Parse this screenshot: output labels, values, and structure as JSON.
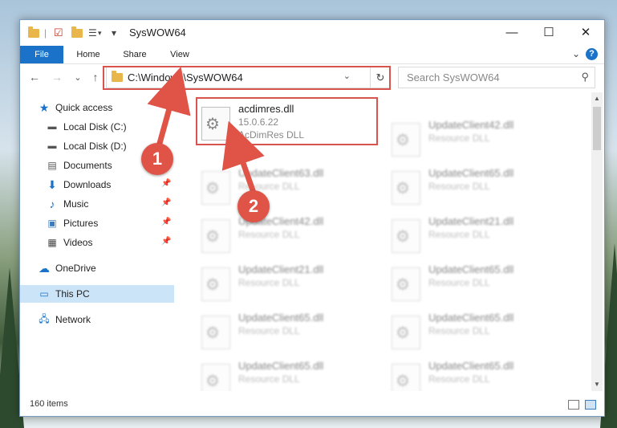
{
  "window": {
    "title": "SysWOW64",
    "controls": {
      "minimize": "—",
      "maximize": "☐",
      "close": "✕"
    }
  },
  "ribbon": {
    "tabs": [
      "File",
      "Home",
      "Share",
      "View"
    ],
    "help": "?",
    "collapse": "⌄"
  },
  "navigation": {
    "back": "←",
    "forward": "→",
    "recent": "⌄",
    "up": "↑",
    "address": "C:\\Windows\\SysWOW64",
    "refresh": "↻",
    "search_placeholder": "Search SysWOW64"
  },
  "sidebar": {
    "quick_access": "Quick access",
    "items": [
      {
        "label": "Local Disk (C:)",
        "icon": "drive-icon",
        "pinned": false
      },
      {
        "label": "Local Disk (D:)",
        "icon": "drive-icon",
        "pinned": false
      },
      {
        "label": "Documents",
        "icon": "document-icon",
        "pinned": false
      },
      {
        "label": "Downloads",
        "icon": "download-icon",
        "pinned": true
      },
      {
        "label": "Music",
        "icon": "music-icon",
        "pinned": true
      },
      {
        "label": "Pictures",
        "icon": "picture-icon",
        "pinned": true
      },
      {
        "label": "Videos",
        "icon": "video-icon",
        "pinned": true
      }
    ],
    "onedrive": "OneDrive",
    "this_pc": "This PC",
    "network": "Network"
  },
  "files": {
    "highlighted": {
      "name": "acdimres.dll",
      "version": "15.0.6.22",
      "description": "AcDimRes DLL"
    },
    "blurred_left": [
      {
        "name": "UpdateClient63.dll",
        "description": "Resource DLL"
      },
      {
        "name": "UpdateClient42.dll",
        "description": "Resource DLL"
      },
      {
        "name": "UpdateClient21.dll",
        "description": "Resource DLL"
      },
      {
        "name": "UpdateClient65.dll",
        "description": "Resource DLL"
      },
      {
        "name": "UpdateClient65.dll",
        "description": "Resource DLL"
      }
    ],
    "blurred_right": [
      {
        "name": "UpdateClient42.dll",
        "description": "Resource DLL"
      },
      {
        "name": "UpdateClient65.dll",
        "description": "Resource DLL"
      },
      {
        "name": "UpdateClient21.dll",
        "description": "Resource DLL"
      },
      {
        "name": "UpdateClient65.dll",
        "description": "Resource DLL"
      },
      {
        "name": "UpdateClient65.dll",
        "description": "Resource DLL"
      },
      {
        "name": "UpdateClient65.dll",
        "description": "Resource DLL"
      }
    ]
  },
  "status": {
    "count": "160 items"
  },
  "annotations": {
    "step1": "1",
    "step2": "2"
  },
  "colors": {
    "accent": "#1a73c9",
    "highlight": "#d9534f",
    "selected": "#cce4f7"
  }
}
